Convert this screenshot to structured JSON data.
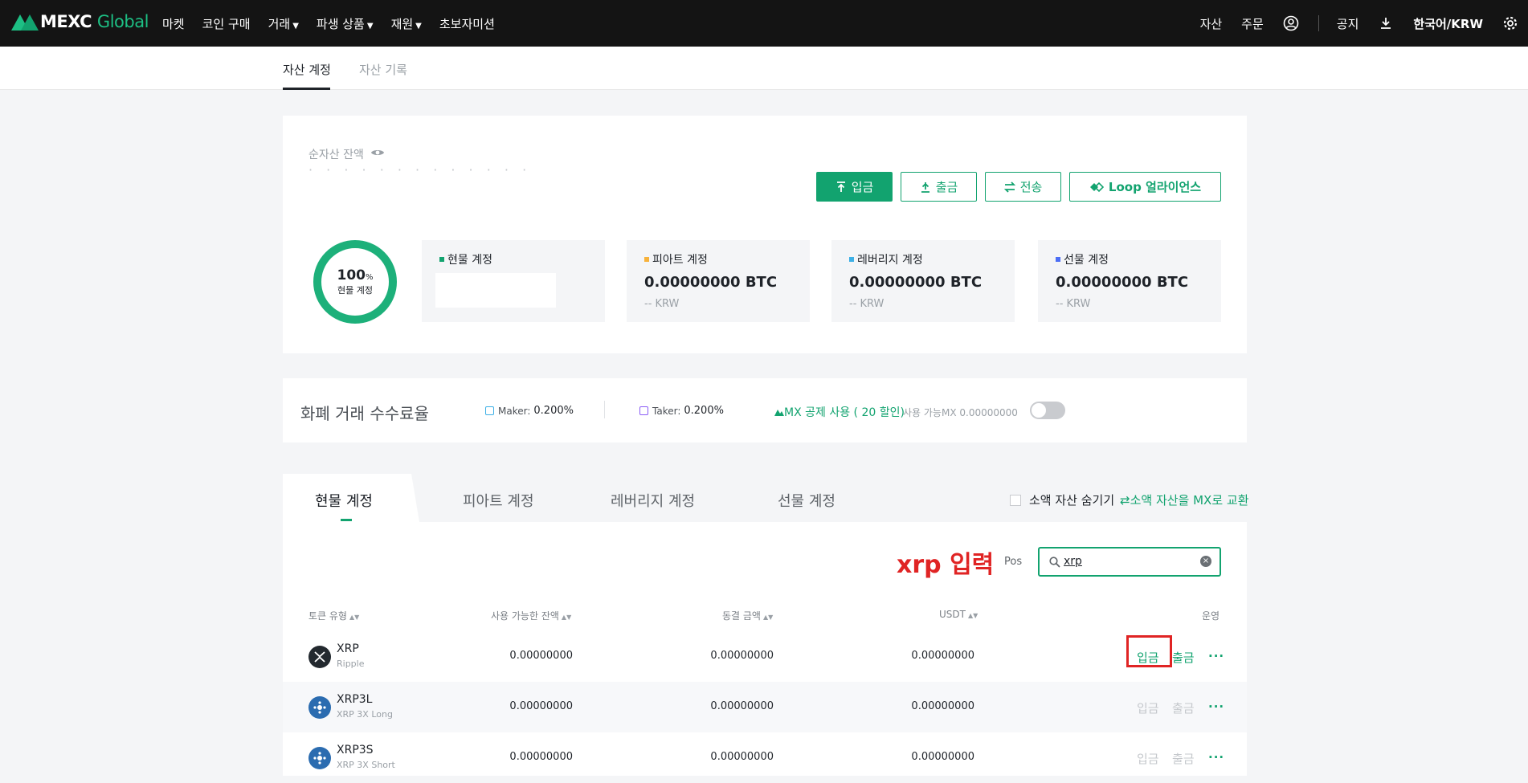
{
  "brand": {
    "name_a": "MEXC",
    "name_b": "Global"
  },
  "nav": {
    "items": [
      {
        "label": "마켓",
        "dropdown": false
      },
      {
        "label": "코인 구매",
        "dropdown": false
      },
      {
        "label": "거래",
        "dropdown": true
      },
      {
        "label": "파생 상품",
        "dropdown": true
      },
      {
        "label": "재원",
        "dropdown": true
      },
      {
        "label": "초보자미션",
        "dropdown": false
      }
    ],
    "right": {
      "assets": "자산",
      "orders": "주문",
      "notice": "공지",
      "language": "한국어/KRW"
    }
  },
  "subnav": {
    "tab_active": "자산 계정",
    "tab_other": "자산 기록"
  },
  "balance": {
    "label": "순자산 잔액",
    "masked": "·  · · · · · · · · ·  · · ·"
  },
  "actions": {
    "deposit": "입금",
    "withdraw": "출금",
    "transfer": "전송",
    "loop": "Loop 얼라이언스"
  },
  "donut": {
    "percent": "100",
    "unit": "%",
    "label": "현물 계정"
  },
  "accounts": [
    {
      "title": "현물 계정",
      "color": "#12a36f",
      "btc": "",
      "krw": ""
    },
    {
      "title": "피아트 계정",
      "color": "#f7b23b",
      "btc": "0.00000000 BTC",
      "krw": "-- KRW"
    },
    {
      "title": "레버리지 계정",
      "color": "#3db0e6",
      "btc": "0.00000000 BTC",
      "krw": "-- KRW"
    },
    {
      "title": "선물 계정",
      "color": "#4c6ef5",
      "btc": "0.00000000 BTC",
      "krw": "-- KRW"
    }
  ],
  "fees": {
    "title": "화폐 거래 수수료율",
    "maker_label": "Maker:",
    "maker_value": "0.200%",
    "taker_label": "Taker:",
    "taker_value": "0.200%",
    "mx_discount": "MX 공제 사용 ( 20 할인)",
    "mx_available": "사용 가능MX 0.00000000",
    "mx_toggle_on": false
  },
  "tabs": {
    "items": [
      "현물 계정",
      "피아트 계정",
      "레버리지 계정",
      "선물 계정"
    ],
    "hide_small": "소액 자산 숨기기",
    "exchange_small": "소액 자산을 MX로 교환"
  },
  "search": {
    "annotation": "xrp 입력",
    "pos_label": "Pos",
    "value": "xrp"
  },
  "table": {
    "headers": {
      "token": "토큰 유형",
      "available": "사용 가능한 잔액",
      "frozen": "동결 금액",
      "usdt": "USDT",
      "ops": "운영"
    },
    "rows": [
      {
        "symbol": "XRP",
        "name": "Ripple",
        "available": "0.00000000",
        "frozen": "0.00000000",
        "usdt": "0.00000000",
        "deposit": "입금",
        "withdraw": "출금",
        "more": "···",
        "enabled": true
      },
      {
        "symbol": "XRP3L",
        "name": "XRP 3X Long",
        "available": "0.00000000",
        "frozen": "0.00000000",
        "usdt": "0.00000000",
        "deposit": "입금",
        "withdraw": "출금",
        "more": "···",
        "enabled": false
      },
      {
        "symbol": "XRP3S",
        "name": "XRP 3X Short",
        "available": "0.00000000",
        "frozen": "0.00000000",
        "usdt": "0.00000000",
        "deposit": "입금",
        "withdraw": "출금",
        "more": "···",
        "enabled": false
      }
    ]
  }
}
